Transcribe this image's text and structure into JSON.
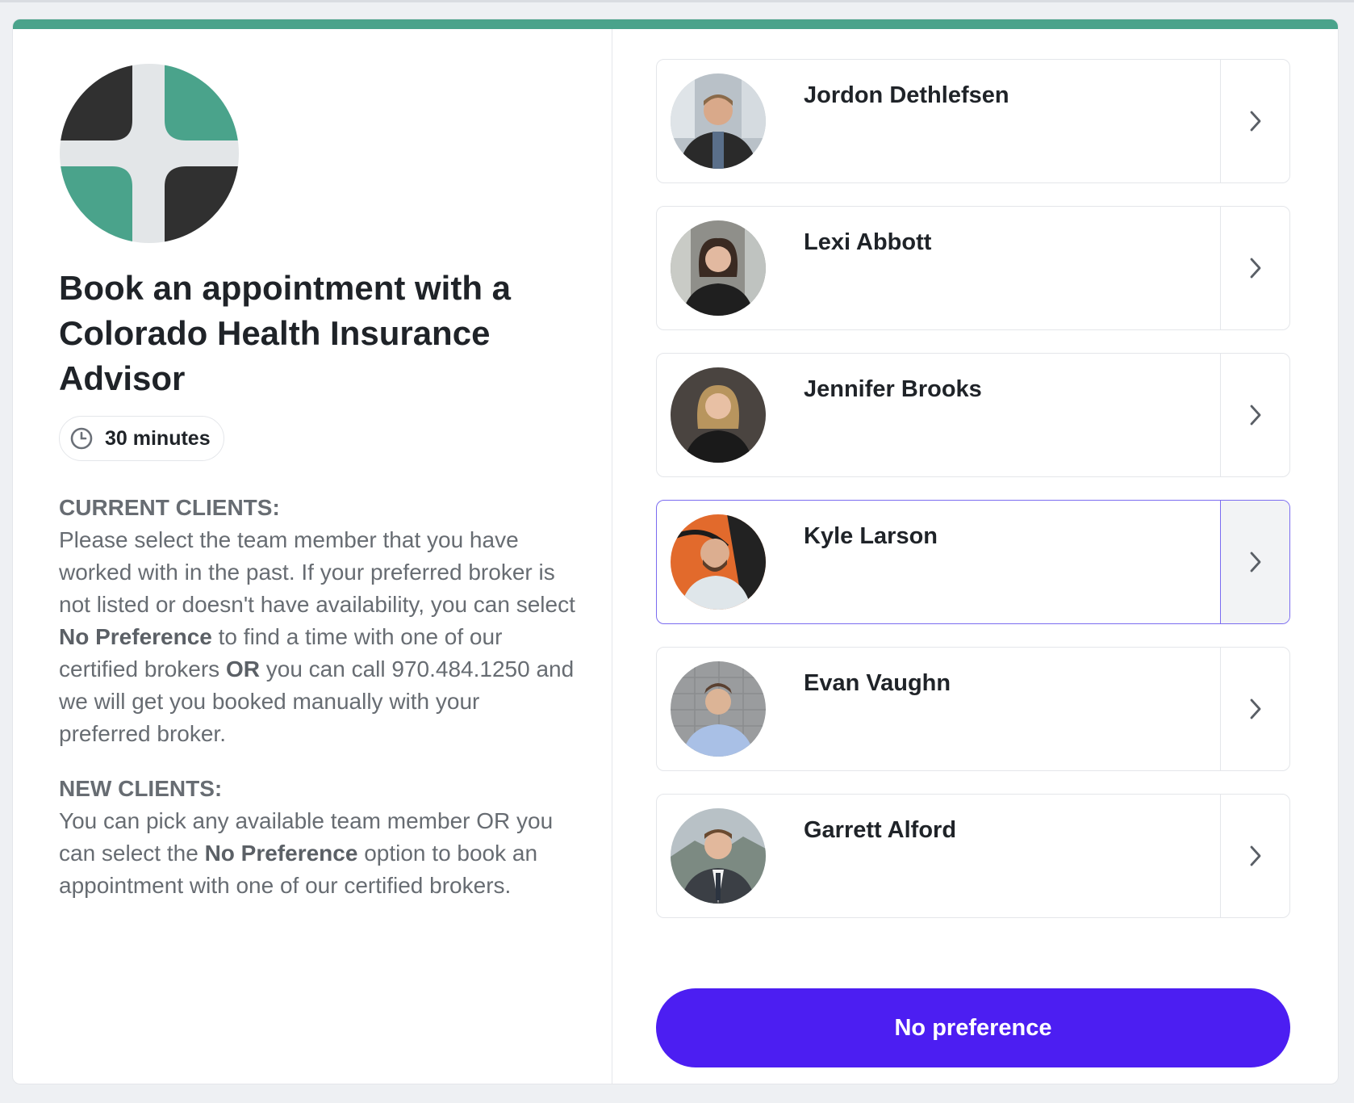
{
  "page": {
    "accent_color": "#4aa38b",
    "primary_color": "#4c1ef2"
  },
  "event": {
    "logo_icon": "health-cross-logo-icon",
    "title": "Book an appointment with a Colorado Health Insurance Advisor",
    "duration_icon": "clock-icon",
    "duration": "30 minutes"
  },
  "description": {
    "current_header": "CURRENT CLIENTS:",
    "current_part1": "Please select the team member that you have worked with in the past. If your preferred broker is not listed or doesn't have availability, you can select ",
    "current_bold1": "No Preference",
    "current_part2": " to find a time with one of our certified brokers ",
    "current_bold2": "OR",
    "current_part3": " you can call 970.484.1250 and we will get you booked manually with your preferred broker.",
    "new_header": "NEW CLIENTS:",
    "new_part1": "You can pick any available team member OR you can select the ",
    "new_bold1": "No Preference",
    "new_part2": " option to book an appointment with one of our certified brokers."
  },
  "team": {
    "members": [
      {
        "name": "Jordon Dethlefsen",
        "avatar_icon": "avatar-photo",
        "chevron_icon": "chevron-right-icon",
        "selected": false
      },
      {
        "name": "Lexi Abbott",
        "avatar_icon": "avatar-photo",
        "chevron_icon": "chevron-right-icon",
        "selected": false
      },
      {
        "name": "Jennifer Brooks",
        "avatar_icon": "avatar-photo",
        "chevron_icon": "chevron-right-icon",
        "selected": false
      },
      {
        "name": "Kyle Larson",
        "avatar_icon": "avatar-photo",
        "chevron_icon": "chevron-right-icon",
        "selected": true
      },
      {
        "name": "Evan Vaughn",
        "avatar_icon": "avatar-photo",
        "chevron_icon": "chevron-right-icon",
        "selected": false
      },
      {
        "name": "Garrett Alford",
        "avatar_icon": "avatar-photo",
        "chevron_icon": "chevron-right-icon",
        "selected": false
      }
    ],
    "no_preference_label": "No preference"
  }
}
